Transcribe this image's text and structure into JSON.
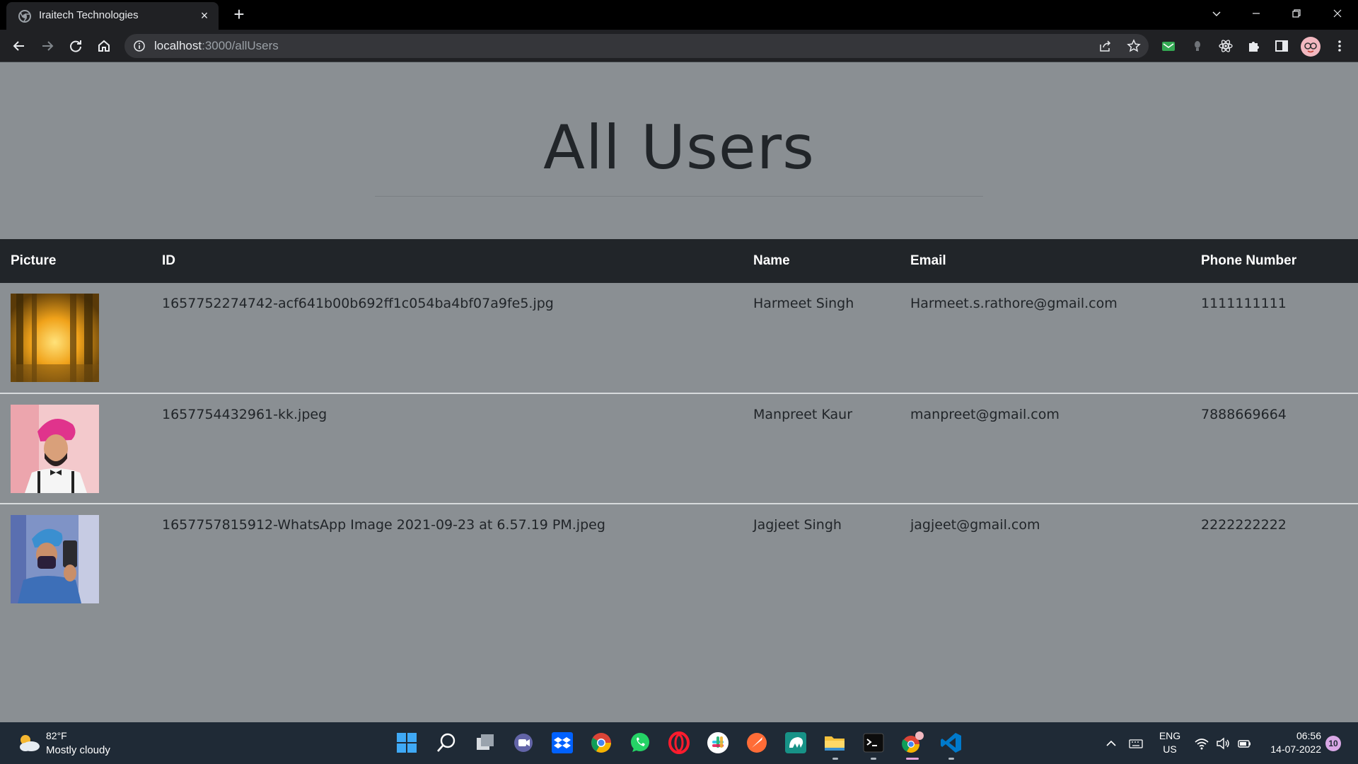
{
  "browser": {
    "tab_title": "Iraitech Technologies",
    "url_host": "localhost",
    "url_path": ":3000/allUsers"
  },
  "page": {
    "title": "All Users",
    "table": {
      "headers": [
        "Picture",
        "ID",
        "Name",
        "Email",
        "Phone Number"
      ],
      "rows": [
        {
          "id": "1657752274742-acf641b00b692ff1c054ba4bf07a9fe5.jpg",
          "name": "Harmeet Singh",
          "email": "Harmeet.s.rathore@gmail.com",
          "phone": "1111111111"
        },
        {
          "id": "1657754432961-kk.jpeg",
          "name": "Manpreet Kaur",
          "email": "manpreet@gmail.com",
          "phone": "7888669664"
        },
        {
          "id": "1657757815912-WhatsApp Image 2021-09-23 at 6.57.19 PM.jpeg",
          "name": "Jagjeet Singh",
          "email": "jagjeet@gmail.com",
          "phone": "2222222222"
        }
      ]
    }
  },
  "taskbar": {
    "weather_temp": "82°F",
    "weather_desc": "Mostly cloudy",
    "lang_1": "ENG",
    "lang_2": "US",
    "time": "06:56",
    "date": "14-07-2022",
    "notification_count": "10"
  },
  "icons": {
    "browser": [
      "chrome-favicon-icon",
      "close-icon",
      "plus-icon",
      "chevron-down-icon",
      "minimize-icon",
      "restore-icon",
      "close-window-icon",
      "back-icon",
      "forward-icon",
      "reload-icon",
      "home-icon",
      "info-icon",
      "share-icon",
      "star-icon",
      "extension-mail-icon",
      "extension-bulb-icon",
      "extension-atom-icon",
      "puzzle-icon",
      "side-panel-icon",
      "profile-avatar",
      "more-icon"
    ],
    "taskbar": [
      "weather-icon",
      "windows-start-icon",
      "search-icon",
      "task-view-icon",
      "teams-icon",
      "dropbox-icon",
      "chrome-icon",
      "whatsapp-icon",
      "opera-icon",
      "slack-icon",
      "postman-icon",
      "gitkraken-icon",
      "file-explorer-icon",
      "terminal-icon",
      "chrome-profile-icon",
      "vscode-icon",
      "chevron-up-icon",
      "keyboard-icon",
      "wifi-icon",
      "volume-icon",
      "battery-icon"
    ]
  },
  "colors": {
    "page_bg": "#8a8f93",
    "table_header_bg": "#212529",
    "browser_bg": "#202124",
    "taskbar_bg": "#1f2a36"
  }
}
